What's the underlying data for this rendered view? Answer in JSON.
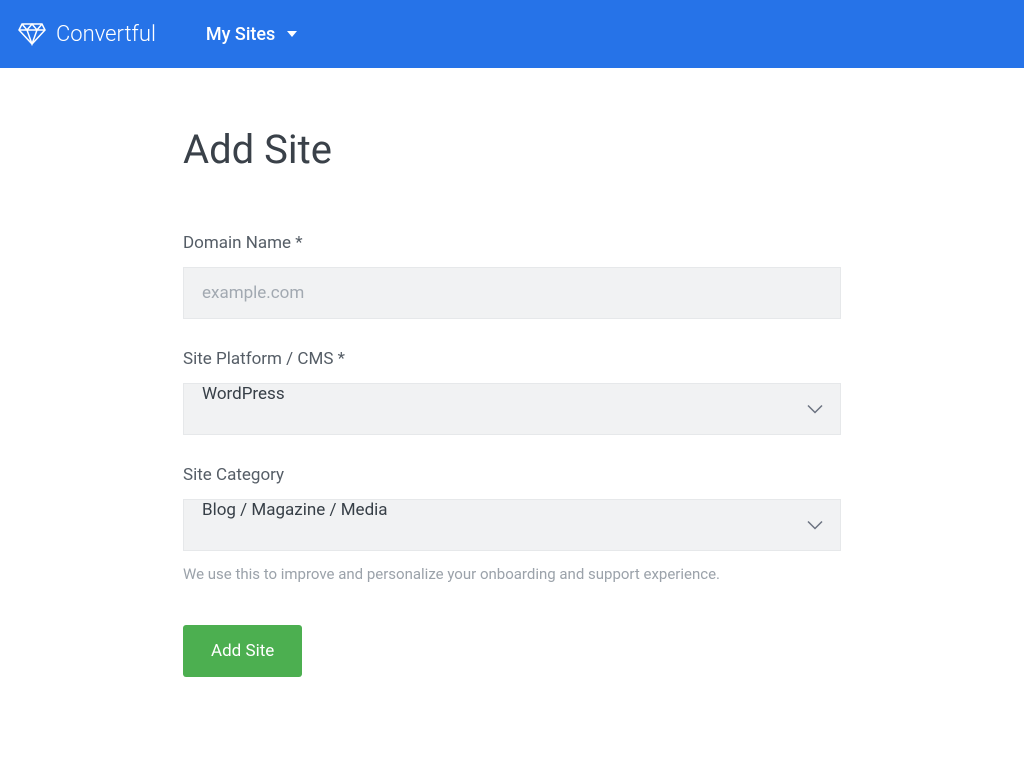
{
  "header": {
    "brand": "Convertful",
    "nav_my_sites": "My Sites"
  },
  "page": {
    "title": "Add Site"
  },
  "form": {
    "domain": {
      "label": "Domain Name *",
      "placeholder": "example.com",
      "value": ""
    },
    "platform": {
      "label": "Site Platform / CMS *",
      "selected": "WordPress"
    },
    "category": {
      "label": "Site Category",
      "selected": "Blog / Magazine / Media",
      "help": "We use this to improve and personalize your onboarding and support experience."
    },
    "submit_label": "Add Site"
  }
}
